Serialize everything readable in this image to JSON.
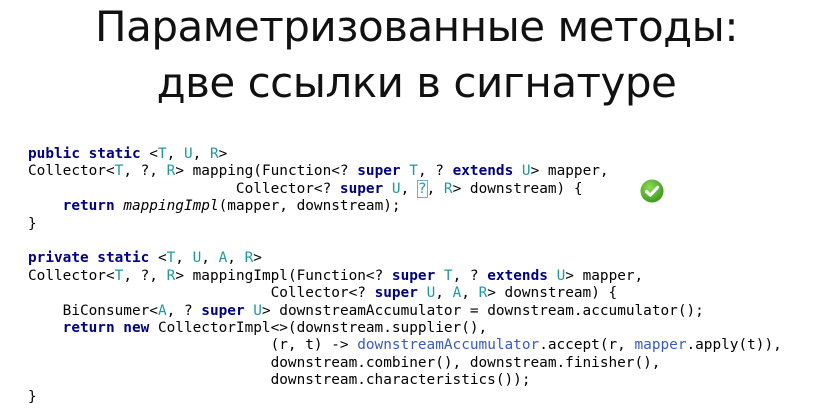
{
  "slide": {
    "title_line1": "Параметризованные методы:",
    "title_line2": "две ссылки в сигнатуре"
  },
  "code_lines": [
    [
      {
        "t": "public static",
        "c": "kw"
      },
      {
        "t": " <"
      },
      {
        "t": "T",
        "c": "tp"
      },
      {
        "t": ", "
      },
      {
        "t": "U",
        "c": "tp"
      },
      {
        "t": ", "
      },
      {
        "t": "R",
        "c": "tp"
      },
      {
        "t": ">"
      }
    ],
    [
      {
        "t": "Collector<"
      },
      {
        "t": "T",
        "c": "tp"
      },
      {
        "t": ", ?, "
      },
      {
        "t": "R",
        "c": "tp"
      },
      {
        "t": "> mapping(Function<? "
      },
      {
        "t": "super",
        "c": "kw"
      },
      {
        "t": " "
      },
      {
        "t": "T",
        "c": "tp"
      },
      {
        "t": ", ? "
      },
      {
        "t": "extends",
        "c": "kw"
      },
      {
        "t": " "
      },
      {
        "t": "U",
        "c": "tp"
      },
      {
        "t": "> mapper,"
      }
    ],
    [
      {
        "t": "                        Collector<? "
      },
      {
        "t": "super",
        "c": "kw"
      },
      {
        "t": " "
      },
      {
        "t": "U",
        "c": "tp"
      },
      {
        "t": ", "
      },
      {
        "t": "?",
        "c": "box"
      },
      {
        "t": ", "
      },
      {
        "t": "R",
        "c": "tp"
      },
      {
        "t": "> downstream) {"
      }
    ],
    [
      {
        "t": "    "
      },
      {
        "t": "return",
        "c": "kw"
      },
      {
        "t": " "
      },
      {
        "t": "mappingImpl",
        "c": "it"
      },
      {
        "t": "(mapper, downstream);"
      }
    ],
    [
      {
        "t": "}"
      }
    ],
    [],
    [
      {
        "t": "private static",
        "c": "kw"
      },
      {
        "t": " <"
      },
      {
        "t": "T",
        "c": "tp"
      },
      {
        "t": ", "
      },
      {
        "t": "U",
        "c": "tp"
      },
      {
        "t": ", "
      },
      {
        "t": "A",
        "c": "tp"
      },
      {
        "t": ", "
      },
      {
        "t": "R",
        "c": "tp"
      },
      {
        "t": ">"
      }
    ],
    [
      {
        "t": "Collector<"
      },
      {
        "t": "T",
        "c": "tp"
      },
      {
        "t": ", ?, "
      },
      {
        "t": "R",
        "c": "tp"
      },
      {
        "t": "> mappingImpl(Function<? "
      },
      {
        "t": "super",
        "c": "kw"
      },
      {
        "t": " "
      },
      {
        "t": "T",
        "c": "tp"
      },
      {
        "t": ", ? "
      },
      {
        "t": "extends",
        "c": "kw"
      },
      {
        "t": " "
      },
      {
        "t": "U",
        "c": "tp"
      },
      {
        "t": "> mapper,"
      }
    ],
    [
      {
        "t": "                            Collector<? "
      },
      {
        "t": "super",
        "c": "kw"
      },
      {
        "t": " "
      },
      {
        "t": "U",
        "c": "tp"
      },
      {
        "t": ", "
      },
      {
        "t": "A",
        "c": "tp"
      },
      {
        "t": ", "
      },
      {
        "t": "R",
        "c": "tp"
      },
      {
        "t": "> downstream) {"
      }
    ],
    [
      {
        "t": "    BiConsumer<"
      },
      {
        "t": "A",
        "c": "tp"
      },
      {
        "t": ", ? "
      },
      {
        "t": "super",
        "c": "kw"
      },
      {
        "t": " "
      },
      {
        "t": "U",
        "c": "tp"
      },
      {
        "t": "> downstreamAccumulator = downstream.accumulator();"
      }
    ],
    [
      {
        "t": "    "
      },
      {
        "t": "return new",
        "c": "kw"
      },
      {
        "t": " CollectorImpl<>(downstream.supplier(),"
      }
    ],
    [
      {
        "t": "                            (r, t) -> "
      },
      {
        "t": "downstreamAccumulator",
        "c": "fd"
      },
      {
        "t": ".accept(r, "
      },
      {
        "t": "mapper",
        "c": "fd"
      },
      {
        "t": ".apply(t)),"
      }
    ],
    [
      {
        "t": "                            downstream.combiner(), downstream.finisher(),"
      }
    ],
    [
      {
        "t": "                            downstream.characteristics());"
      }
    ],
    [
      {
        "t": "}"
      }
    ]
  ],
  "icons": {
    "check": {
      "name": "check-mark-icon",
      "fill": "#4caf2a",
      "glyph": "✓"
    }
  }
}
